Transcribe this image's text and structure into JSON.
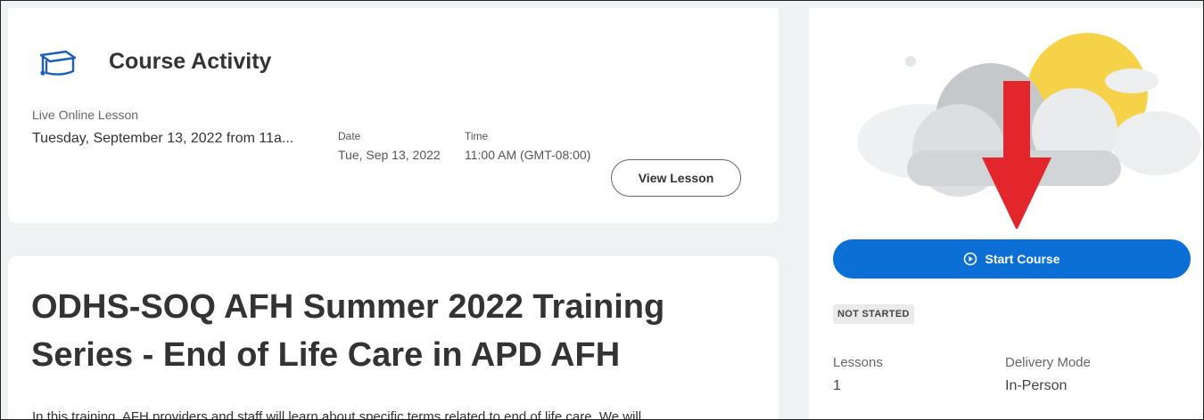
{
  "activity": {
    "title": "Course Activity",
    "icon": "graduation-cap-icon",
    "lesson_type": "Live Online Lesson",
    "lesson_datetime": "Tuesday, September 13, 2022 from 11a...",
    "date_label": "Date",
    "date_value": "Tue, Sep 13, 2022",
    "time_label": "Time",
    "time_value": "11:00 AM (GMT-08:00)",
    "view_button": "View Lesson"
  },
  "course": {
    "title": "ODHS-SOQ AFH Summer 2022 Training Series - End of Life Care in APD AFH",
    "description": "In this training, AFH providers and staff will learn about specific terms related to end of life care. We will"
  },
  "side": {
    "start_button": "Start Course",
    "start_icon": "play-circle-icon",
    "status": "NOT STARTED",
    "lessons_label": "Lessons",
    "lessons_value": "1",
    "delivery_label": "Delivery Mode",
    "delivery_value": "In-Person"
  },
  "colors": {
    "accent": "#0b6fd6",
    "arrow": "#e3262b",
    "sun": "#f6d248"
  }
}
